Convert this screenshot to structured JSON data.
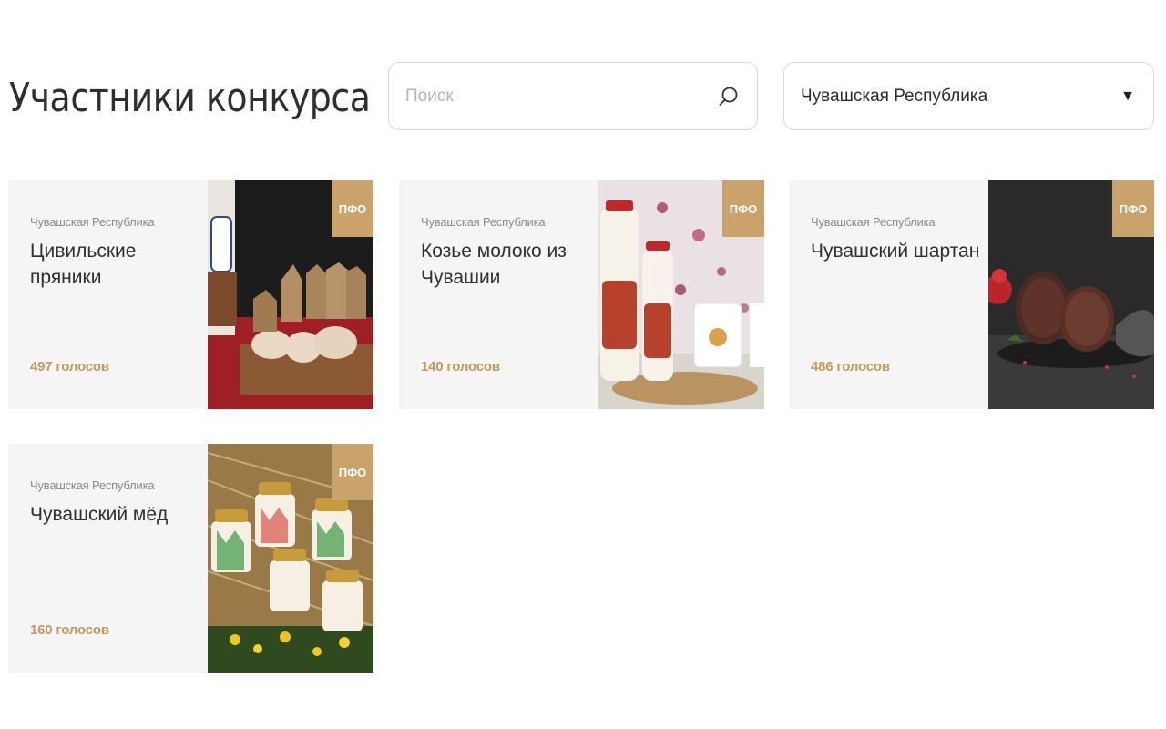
{
  "header": {
    "title": "Участники конкурса"
  },
  "search": {
    "placeholder": "Поиск",
    "value": ""
  },
  "region_filter": {
    "selected": "Чувашская Республика"
  },
  "cards": [
    {
      "region": "Чувашская Республика",
      "name": "Цивильские пряники",
      "votes": "497 голосов",
      "badge": "ПФО"
    },
    {
      "region": "Чувашская Республика",
      "name": "Козье молоко из Чувашии",
      "votes": "140 голосов",
      "badge": "ПФО"
    },
    {
      "region": "Чувашская Республика",
      "name": "Чувашский шартан",
      "votes": "486 голосов",
      "badge": "ПФО"
    },
    {
      "region": "Чувашская Республика",
      "name": "Чувашский мёд",
      "votes": "160 голосов",
      "badge": "ПФО"
    }
  ],
  "colors": {
    "accent": "#c49a5d",
    "badge": "#c9a36b",
    "card_bg": "#f5f5f5"
  }
}
